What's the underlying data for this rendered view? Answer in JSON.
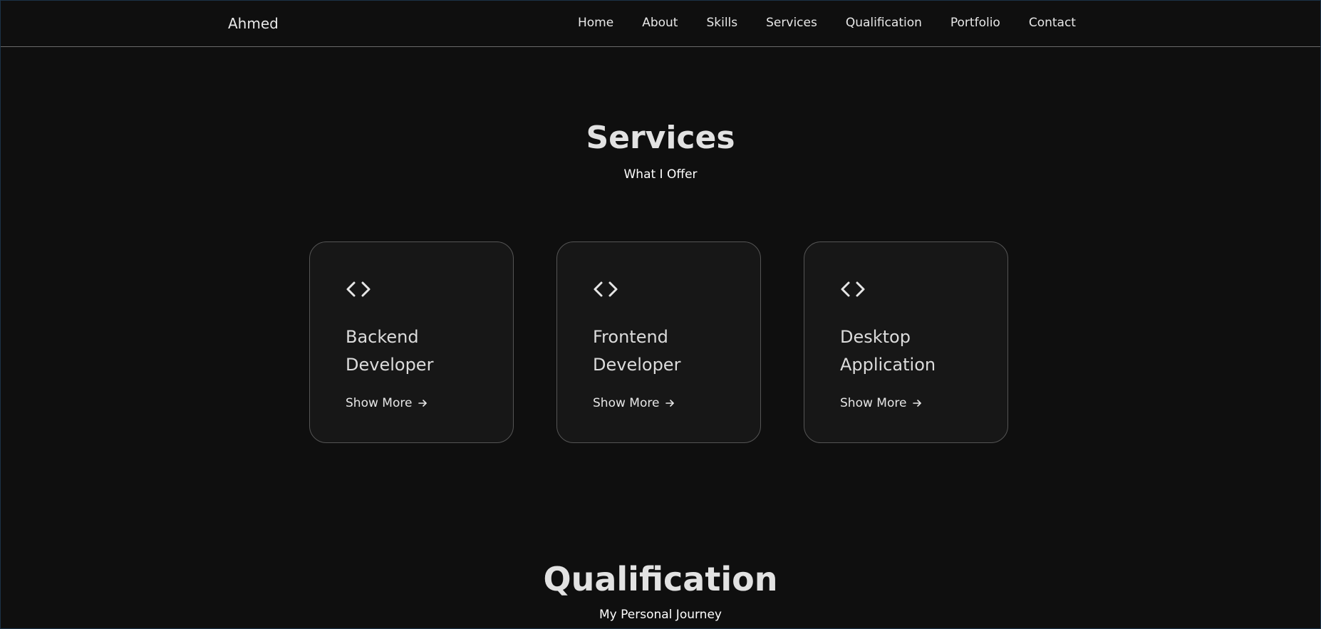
{
  "header": {
    "logo": "Ahmed",
    "nav": [
      "Home",
      "About",
      "Skills",
      "Services",
      "Qualification",
      "Portfolio",
      "Contact"
    ]
  },
  "services": {
    "title": "Services",
    "subtitle": "What I Offer",
    "cards": [
      {
        "icon": "code-icon",
        "title": "Backend Developer",
        "link": "Show More",
        "link_icon": "arrow-right-icon"
      },
      {
        "icon": "code-icon",
        "title": "Frontend Developer",
        "link": "Show More",
        "link_icon": "arrow-right-icon"
      },
      {
        "icon": "code-icon",
        "title": "Desktop Application",
        "link": "Show More",
        "link_icon": "arrow-right-icon"
      }
    ]
  },
  "qualification": {
    "title": "Qualification",
    "subtitle": "My Personal Journey"
  },
  "colors": {
    "background": "#0f0f0f",
    "card_background": "#171717",
    "card_border": "#555555",
    "text": "#e4e4e4"
  }
}
